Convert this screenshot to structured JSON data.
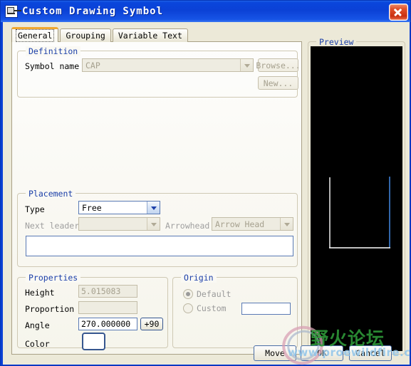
{
  "window": {
    "title": "Custom Drawing Symbol",
    "icon": "window-symbol-icon",
    "close_label": "Close"
  },
  "tabs": [
    {
      "label": "General",
      "active": true
    },
    {
      "label": "Grouping",
      "active": false
    },
    {
      "label": "Variable Text",
      "active": false
    }
  ],
  "definition": {
    "title": "Definition",
    "symbol_name_label": "Symbol name",
    "symbol_name_value": "CAP",
    "browse_label": "Browse...",
    "new_label": "New..."
  },
  "placement": {
    "title": "Placement",
    "type_label": "Type",
    "type_value": "Free",
    "next_leader_label": "Next leader",
    "next_leader_value": "",
    "arrowhead_label": "Arrowhead",
    "arrowhead_value": "Arrow Head",
    "list_value": ""
  },
  "properties": {
    "title": "Properties",
    "height_label": "Height",
    "height_value": "5.015083",
    "proportion_label": "Proportion",
    "proportion_value": "",
    "angle_label": "Angle",
    "angle_value": "270.000000",
    "angle_step_label": "+90",
    "color_label": "Color",
    "color_value": "#ffffff"
  },
  "origin": {
    "title": "Origin",
    "default_label": "Default",
    "custom_label": "Custom",
    "custom_value": "",
    "selected": "Default"
  },
  "preview": {
    "title": "Preview",
    "background_color": "#000000",
    "symbol": {
      "name": "CAP",
      "left_plate_color": "#ffffff",
      "right_plate_color": "#3f7fd4",
      "baseline_color": "#ffffff"
    }
  },
  "footer": {
    "move_label": "Move",
    "ok_label": "OK",
    "cancel_label": "Cancel"
  },
  "watermark": {
    "text_cn": "野火论坛",
    "url": "www.proewildfire.cn"
  }
}
